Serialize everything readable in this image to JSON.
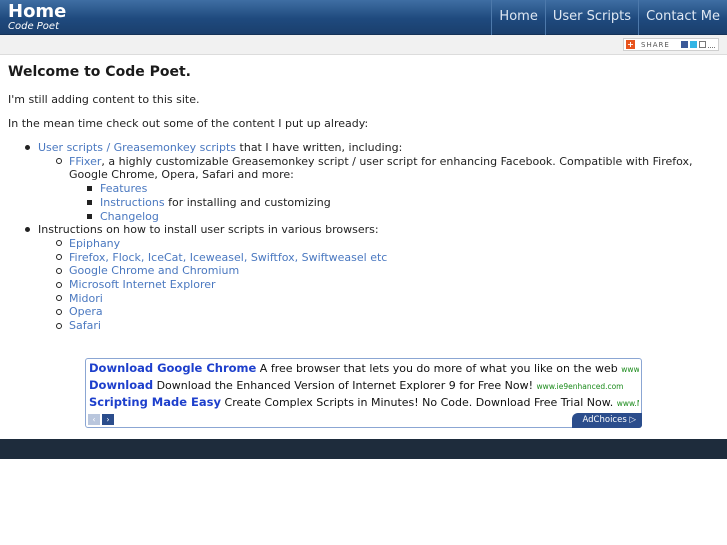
{
  "header": {
    "title": "Home",
    "subtitle": "Code Poet",
    "nav": [
      "Home",
      "User Scripts",
      "Contact Me"
    ]
  },
  "share": {
    "label": "SHARE",
    "plus_icon": "addthis-plus-icon",
    "icons": [
      "facebook-icon",
      "twitter-icon",
      "email-icon",
      "more-icon"
    ]
  },
  "main": {
    "title": "Welcome to Code Poet.",
    "para1": "I'm still adding content to this site.",
    "para2": "In the mean time check out some of the content I put up already:",
    "list": {
      "item1_link": "User scripts / Greasemonkey scripts",
      "item1_text": " that I have written, including:",
      "ffixer_link": "FFixer",
      "ffixer_text": ", a highly customizable Greasemonkey script / user script for enhancing Facebook. Compatible with Firefox, Google Chrome, Opera, Safari and more:",
      "ffixer_sub": {
        "features": "Features",
        "instructions": "Instructions",
        "instructions_text": " for installing and customizing",
        "changelog": "Changelog"
      },
      "item2_text": "Instructions on how to install user scripts in various browsers:",
      "browsers": [
        "Epiphany",
        "Firefox, Flock, IceCat, Iceweasel, Swiftfox, Swiftweasel etc",
        "Google Chrome and Chromium",
        "Microsoft Internet Explorer",
        "Midori",
        "Opera",
        "Safari"
      ]
    }
  },
  "ads": {
    "rows": [
      {
        "head": "Download Google Chrome",
        "text": " A free browser that lets you do more of what you like on the web ",
        "url": "www.goog..."
      },
      {
        "head": "Download",
        "text": " Download the Enhanced Version of Internet Explorer 9 for Free Now! ",
        "url": "www.ie9enhanced.com"
      },
      {
        "head": "Scripting Made Easy",
        "text": " Create Complex Scripts in Minutes! No Code. Download Free Trial Now. ",
        "url": "www.Netwo..."
      }
    ],
    "adchoices": "AdChoices ▷",
    "prev": "‹",
    "next": "›"
  }
}
